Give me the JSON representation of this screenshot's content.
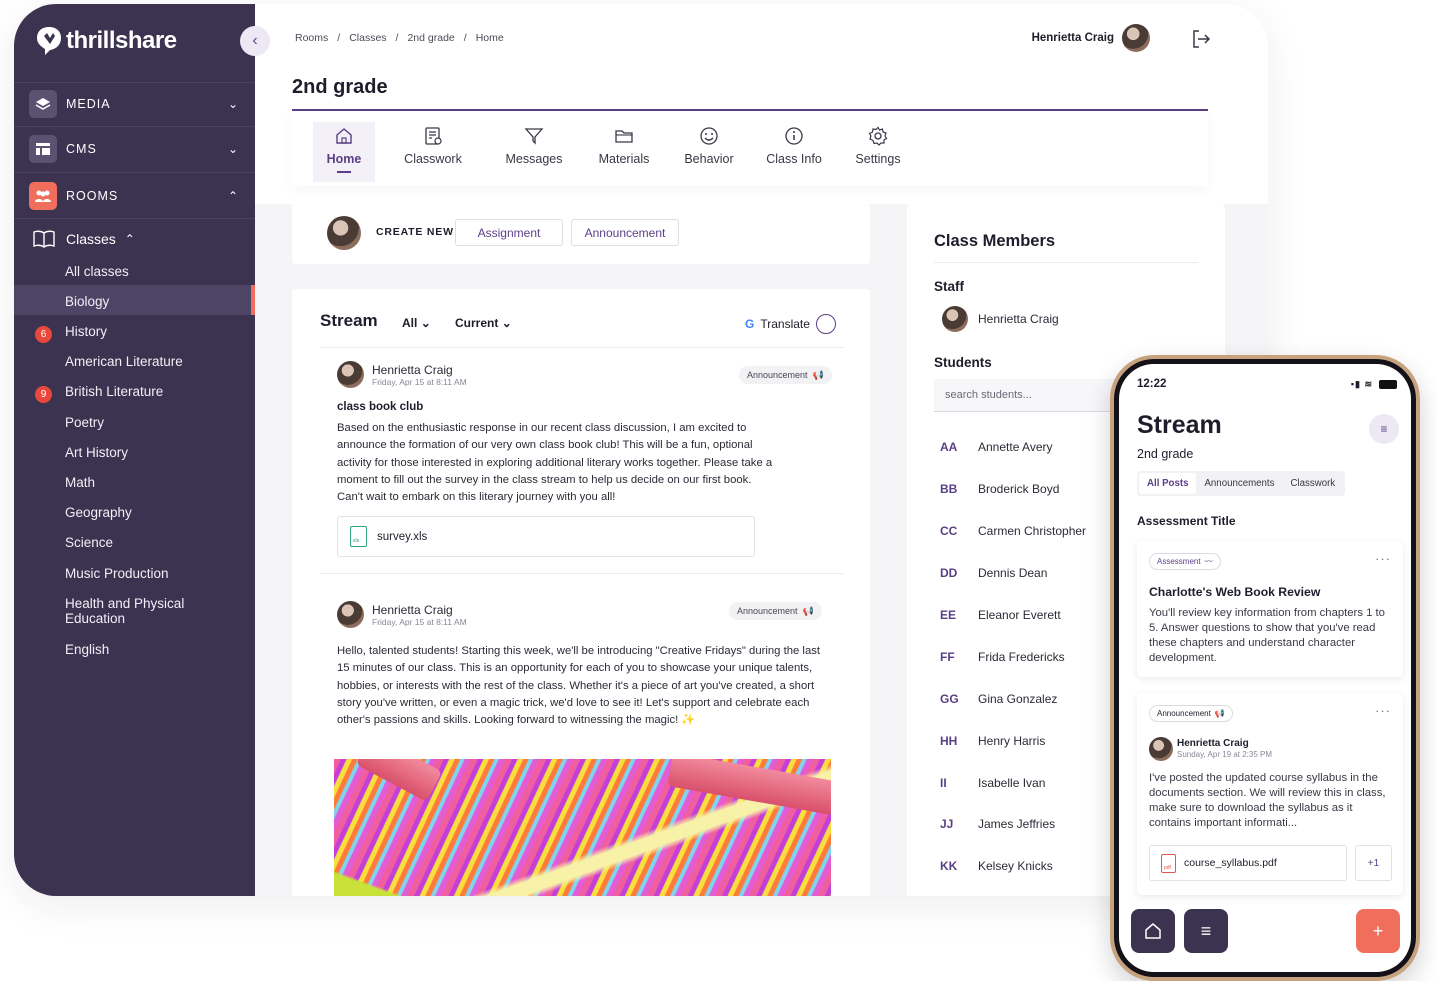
{
  "brand": {
    "name": "thrillshare",
    "accent": "#5b3f86",
    "sidebar_bg": "#3b3350",
    "coral": "#f06e5c"
  },
  "sidebar": {
    "sections": [
      {
        "label": "MEDIA",
        "icon": "layers-icon",
        "expanded": false
      },
      {
        "label": "CMS",
        "icon": "layout-icon",
        "expanded": false
      },
      {
        "label": "ROOMS",
        "icon": "people-icon",
        "expanded": true
      }
    ],
    "classes_label": "Classes",
    "items": [
      {
        "label": "All classes"
      },
      {
        "label": "Biology",
        "active": true
      },
      {
        "label": "History",
        "badge": "6"
      },
      {
        "label": "American Literature"
      },
      {
        "label": "British Literature",
        "badge": "9"
      },
      {
        "label": "Poetry"
      },
      {
        "label": "Art History"
      },
      {
        "label": "Math"
      },
      {
        "label": "Geography"
      },
      {
        "label": "Science"
      },
      {
        "label": "Music Production"
      },
      {
        "label": "Health and Physical Education"
      },
      {
        "label": "English"
      }
    ]
  },
  "breadcrumb": [
    "Rooms",
    "/",
    "Classes",
    "/",
    "2nd grade",
    "/",
    "Home"
  ],
  "user": {
    "name": "Henrietta Craig"
  },
  "page_title": "2nd grade",
  "tabs": [
    {
      "label": "Home",
      "icon": "home-icon",
      "active": true
    },
    {
      "label": "Classwork",
      "icon": "classwork-icon"
    },
    {
      "label": "Messages",
      "icon": "send-icon"
    },
    {
      "label": "Materials",
      "icon": "folder-icon"
    },
    {
      "label": "Behavior",
      "icon": "smile-icon"
    },
    {
      "label": "Class Info",
      "icon": "info-icon"
    },
    {
      "label": "Settings",
      "icon": "gear-icon"
    }
  ],
  "create": {
    "label": "CREATE NEW",
    "assignment": "Assignment",
    "announcement": "Announcement"
  },
  "stream": {
    "title": "Stream",
    "filter_all": "All",
    "filter_current": "Current",
    "translate": "Translate",
    "posts": [
      {
        "author": "Henrietta Craig",
        "date": "Friday, Apr 15 at 8:11 AM",
        "tag": "Announcement",
        "title": "class book club",
        "body": "Based on the enthusiastic response in our recent class discussion, I am excited to announce the formation of our very own class book club! This will be a fun, optional activity for those interested in exploring additional literary works together. Please take a moment to fill out the survey in the class stream to help us decide on our first book. Can't wait to embark on this literary journey with you all!",
        "file": "survey.xls"
      },
      {
        "author": "Henrietta Craig",
        "date": "Friday, Apr 15 at 8:11 AM",
        "tag": "Announcement",
        "body": "Hello, talented students! Starting this week, we'll be introducing \"Creative Fridays\" during the last 15 minutes of our class. This is an opportunity for each of you to showcase your unique talents, hobbies, or interests with the rest of the class. Whether it's a piece of art you've created, a short story you've written, or even a magic trick, we'd love to see it! Let's support and celebrate each other's passions and skills. Looking forward to witnessing the magic! ✨"
      }
    ]
  },
  "members": {
    "title": "Class Members",
    "staff_label": "Staff",
    "staff": [
      "Henrietta Craig"
    ],
    "students_label": "Students",
    "search_placeholder": "search students...",
    "students": [
      {
        "initials": "AA",
        "name": "Annette Avery"
      },
      {
        "initials": "BB",
        "name": "Broderick Boyd"
      },
      {
        "initials": "CC",
        "name": "Carmen Christopher"
      },
      {
        "initials": "DD",
        "name": "Dennis Dean"
      },
      {
        "initials": "EE",
        "name": "Eleanor Everett"
      },
      {
        "initials": "FF",
        "name": "Frida Fredericks"
      },
      {
        "initials": "GG",
        "name": "Gina Gonzalez"
      },
      {
        "initials": "HH",
        "name": "Henry Harris"
      },
      {
        "initials": "II",
        "name": "Isabelle Ivan"
      },
      {
        "initials": "JJ",
        "name": "James Jeffries"
      },
      {
        "initials": "KK",
        "name": "Kelsey Knicks"
      }
    ]
  },
  "phone": {
    "time": "12:22",
    "title": "Stream",
    "subtitle": "2nd grade",
    "tabs": [
      "All Posts",
      "Announcements",
      "Classwork"
    ],
    "section": "Assessment Title",
    "card1": {
      "tag": "Assessment",
      "title": "Charlotte's Web Book Review",
      "body": "You'll review key information from chapters 1 to 5. Answer questions to show that you've read these chapters and understand character development."
    },
    "card2": {
      "tag": "Announcement",
      "author": "Henrietta Craig",
      "date": "Sunday, Apr 19 at 2:35 PM",
      "body": "I've posted the updated course syllabus in the documents section. We will review this in class, make sure to download the syllabus as it contains important informati...",
      "file": "course_syllabus.pdf",
      "more": "+1"
    }
  }
}
